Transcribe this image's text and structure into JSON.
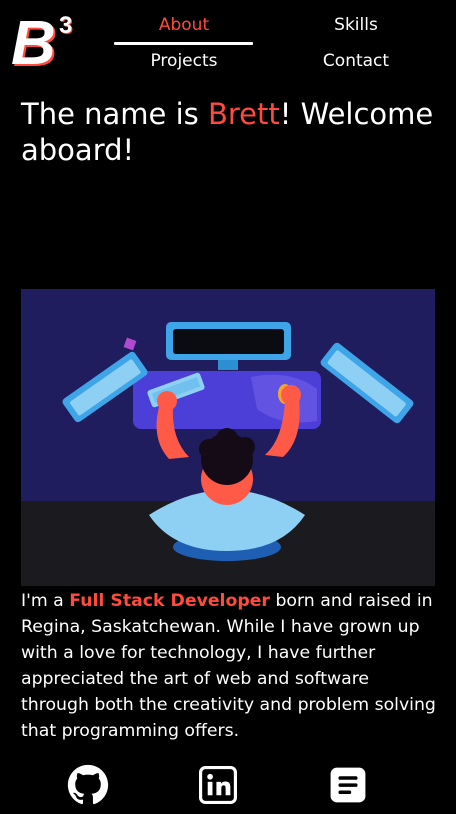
{
  "logo": {
    "letter": "B",
    "superscript": "3"
  },
  "nav": {
    "about": "About",
    "skills": "Skills",
    "projects": "Projects",
    "contact": "Contact",
    "active": "about"
  },
  "hero": {
    "intro": "The name is ",
    "name": "Brett",
    "rest": "! Welcome aboard!"
  },
  "bio": {
    "lead": "I'm a ",
    "role": "Full Stack Developer",
    "rest": " born and raised in Regina, Saskatchewan. While I have grown up with a love for technology, I have further appreciated the art of web and software through both the creativity and problem solving that programming offers."
  },
  "social": [
    {
      "icon": "github-icon"
    },
    {
      "icon": "linkedin-icon"
    },
    {
      "icon": "resume-icon"
    }
  ],
  "colors": {
    "accent": "#ff4a3d",
    "background": "#000000",
    "illustration_bg": "#1f1d5e"
  }
}
